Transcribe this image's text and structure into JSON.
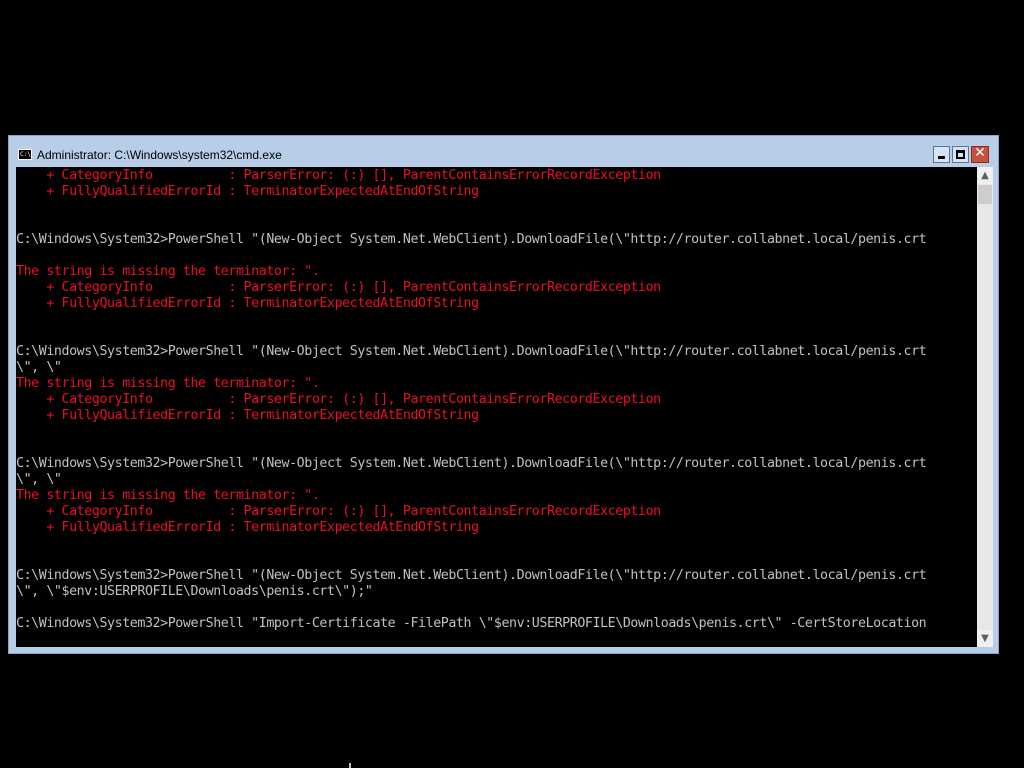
{
  "window": {
    "title": "Administrator: C:\\Windows\\system32\\cmd.exe",
    "icon": "cmd-icon",
    "buttons": {
      "minimize": "minimize-icon",
      "maximize": "maximize-icon",
      "close": "close-icon"
    }
  },
  "colors": {
    "normal_text": "#c0c0c0",
    "error_text": "#e81123",
    "console_bg": "#000000",
    "frame": "#b7cde8"
  },
  "console": {
    "lines": [
      {
        "type": "error",
        "text": "    + CategoryInfo          : ParserError: (:) [], ParentContainsErrorRecordException"
      },
      {
        "type": "error",
        "text": "    + FullyQualifiedErrorId : TerminatorExpectedAtEndOfString"
      },
      {
        "type": "normal",
        "text": ""
      },
      {
        "type": "normal",
        "text": ""
      },
      {
        "type": "normal",
        "text": "C:\\Windows\\System32>PowerShell \"(New-Object System.Net.WebClient).DownloadFile(\\\"http://router.collabnet.local/penis.crt"
      },
      {
        "type": "normal",
        "text": ""
      },
      {
        "type": "error",
        "text": "The string is missing the terminator: \"."
      },
      {
        "type": "error",
        "text": "    + CategoryInfo          : ParserError: (:) [], ParentContainsErrorRecordException"
      },
      {
        "type": "error",
        "text": "    + FullyQualifiedErrorId : TerminatorExpectedAtEndOfString"
      },
      {
        "type": "normal",
        "text": ""
      },
      {
        "type": "normal",
        "text": ""
      },
      {
        "type": "normal",
        "text": "C:\\Windows\\System32>PowerShell \"(New-Object System.Net.WebClient).DownloadFile(\\\"http://router.collabnet.local/penis.crt"
      },
      {
        "type": "normal",
        "text": "\\\", \\\""
      },
      {
        "type": "error",
        "text": "The string is missing the terminator: \"."
      },
      {
        "type": "error",
        "text": "    + CategoryInfo          : ParserError: (:) [], ParentContainsErrorRecordException"
      },
      {
        "type": "error",
        "text": "    + FullyQualifiedErrorId : TerminatorExpectedAtEndOfString"
      },
      {
        "type": "normal",
        "text": ""
      },
      {
        "type": "normal",
        "text": ""
      },
      {
        "type": "normal",
        "text": "C:\\Windows\\System32>PowerShell \"(New-Object System.Net.WebClient).DownloadFile(\\\"http://router.collabnet.local/penis.crt"
      },
      {
        "type": "normal",
        "text": "\\\", \\\""
      },
      {
        "type": "error",
        "text": "The string is missing the terminator: \"."
      },
      {
        "type": "error",
        "text": "    + CategoryInfo          : ParserError: (:) [], ParentContainsErrorRecordException"
      },
      {
        "type": "error",
        "text": "    + FullyQualifiedErrorId : TerminatorExpectedAtEndOfString"
      },
      {
        "type": "normal",
        "text": ""
      },
      {
        "type": "normal",
        "text": ""
      },
      {
        "type": "normal",
        "text": "C:\\Windows\\System32>PowerShell \"(New-Object System.Net.WebClient).DownloadFile(\\\"http://router.collabnet.local/penis.crt"
      },
      {
        "type": "normal",
        "text": "\\\", \\\"$env:USERPROFILE\\Downloads\\penis.crt\\\");\""
      },
      {
        "type": "normal",
        "text": ""
      },
      {
        "type": "normal",
        "text": "C:\\Windows\\System32>PowerShell \"Import-Certificate -FilePath \\\"$env:USERPROFILE\\Downloads\\penis.crt\\\" -CertStoreLocation"
      }
    ]
  },
  "scrollbar": {
    "up_arrow": "▲",
    "down_arrow": "▼"
  }
}
